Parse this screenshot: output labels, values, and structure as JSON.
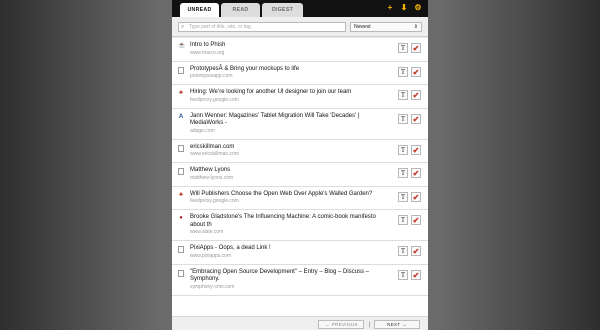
{
  "tabs": [
    "UNREAD",
    "READ",
    "DIGEST"
  ],
  "header_icons": [
    "add-icon",
    "download-icon",
    "gear-icon"
  ],
  "accent": "#f2b400",
  "search": {
    "placeholder": "Type part of title, site, or tag"
  },
  "sort": {
    "selected": "Newest"
  },
  "items": [
    {
      "title": "Intro to Phish",
      "url": "www.marco.org",
      "icon": "coffee-icon"
    },
    {
      "title": "PrototypesÂ & Bring your mockups to life",
      "url": "prototypesapp.com",
      "icon": "page-icon"
    },
    {
      "title": "Hiring: We’re looking for another UI designer to join our team",
      "url": "feedproxy.google.com",
      "icon": "feed-icon"
    },
    {
      "title": "Jann Wenner: Magazines' Tablet Migration Will Take 'Decades' | MediaWorks -",
      "url": "adage.com",
      "icon": "adage-icon"
    },
    {
      "title": "ericskillman.com",
      "url": "www.ericskillman.com",
      "icon": "page-icon"
    },
    {
      "title": "Matthew Lyons",
      "url": "matthew-lyons.com",
      "icon": "page-icon"
    },
    {
      "title": "Will Publishers Choose the Open Web Over Apple's Walled Garden?",
      "url": "feedproxy.google.com",
      "icon": "feed-icon"
    },
    {
      "title": "Brooke Gladstone's The Influencing Machine: A comic-book manifesto about th",
      "url": "www.slate.com",
      "icon": "slate-icon"
    },
    {
      "title": "PixiApps - Oops, a dead Link !",
      "url": "www.pixiapps.com",
      "icon": "page-icon"
    },
    {
      "title": "\"Embracing Open Source Development\" – Entry – Blog – Discuss – Symphony.",
      "url": "symphony-cms.com",
      "icon": "page-icon"
    }
  ],
  "actions": {
    "text": "T",
    "check": "✔"
  },
  "pager": {
    "previous": "← PREVIOUS",
    "separator": "|",
    "next": "NEXT →"
  }
}
